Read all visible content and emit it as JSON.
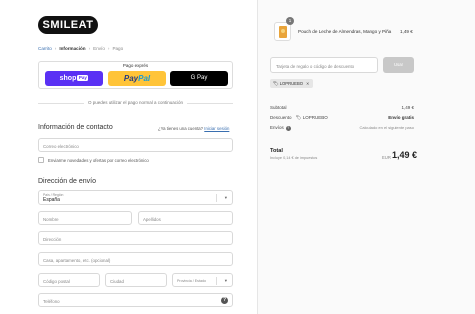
{
  "brand": {
    "logo_text": "SMILEAT"
  },
  "breadcrumb": {
    "cart": "Carrito",
    "info": "Información",
    "shipping": "Envío",
    "payment": "Pago",
    "sep": "›"
  },
  "express": {
    "title": "Pago exprés",
    "shoppay": "shop",
    "shoppay_badge": "Pay",
    "paypal_a": "Pay",
    "paypal_b": "Pal",
    "gpay": "G Pay"
  },
  "divider_text": "O puedes utilizar el pago normal a continuación",
  "contact": {
    "heading": "Información de contacto",
    "login_question": "¿Ya tienes una cuenta?",
    "login_link": "Iniciar sesión",
    "email_placeholder": "Correo electrónico",
    "newsletter_label": "Enviarme novedades y ofertas por correo electrónico"
  },
  "shipping": {
    "heading": "Dirección de envío",
    "country_label": "País / Región",
    "country_value": "España",
    "first_name": "Nombre",
    "last_name": "Apellidos",
    "address": "Dirección",
    "address2": "Casa, apartamento, etc. (opcional)",
    "postal": "Código postal",
    "city": "Ciudad",
    "province": "Provincia / Estado",
    "phone": "Teléfono"
  },
  "order": {
    "product_name": "Pouch de Leche de Almendras, Mango y Piña",
    "product_price": "1,49 €",
    "quantity": "1",
    "discount_placeholder": "Tarjeta de regalo o código de descuento",
    "apply_label": "Usar",
    "tag_code": "LOPRUEBO",
    "subtotal_label": "Subtotal",
    "subtotal_value": "1,49 €",
    "discount_label": "Descuento",
    "discount_code": "LOPRUEBO",
    "discount_value": "Envío gratis",
    "shipping_label": "Envíos",
    "shipping_value": "Calculado en el siguiente paso",
    "total_label": "Total",
    "total_sub": "Incluye 0,14 € de impuestos",
    "currency": "EUR",
    "total_value": "1,49 €"
  },
  "icons": {
    "info": "info-icon",
    "tag": "tag-icon",
    "close": "close-icon",
    "chevron": "chevron-down-icon",
    "help": "help-icon"
  }
}
